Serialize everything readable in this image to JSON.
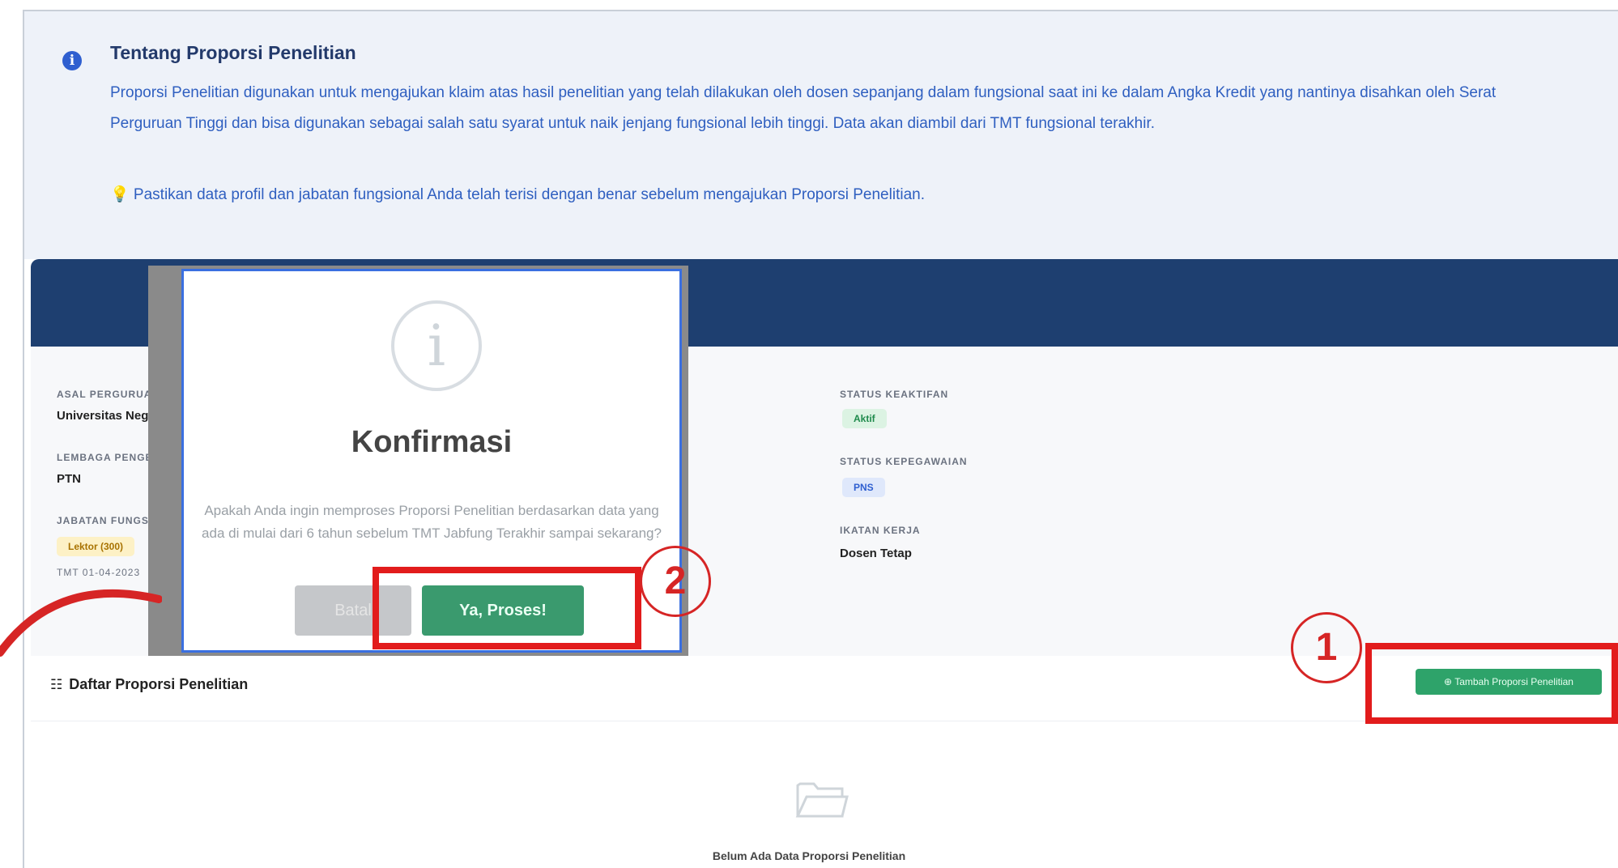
{
  "info": {
    "title": "Tentang Proporsi Penelitian",
    "text": "Proporsi Penelitian digunakan untuk mengajukan klaim atas hasil penelitian yang telah dilakukan oleh dosen sepanjang dalam fungsional saat ini ke dalam Angka Kredit yang nantinya disahkan oleh Serat Perguruan Tinggi dan bisa digunakan sebagai salah satu syarat untuk naik jenjang fungsional lebih tinggi. Data akan diambil dari TMT fungsional terakhir.",
    "tip": "💡 Pastikan data profil dan jabatan fungsional Anda telah terisi dengan benar sebelum mengajukan Proporsi Penelitian."
  },
  "profile": {
    "left": [
      {
        "label": "ASAL PERGURUAN",
        "value": "Universitas Negeri"
      },
      {
        "label": "LEMBAGA PENGEL",
        "value": "PTN"
      },
      {
        "label": "JABATAN FUNGSIO",
        "badge": "Lektor (300)",
        "sub": "TMT 01-04-2023"
      }
    ],
    "right": [
      {
        "label": "STATUS KEAKTIFAN",
        "badge": "Aktif"
      },
      {
        "label": "STATUS KEPEGAWAIAN",
        "badge": "PNS"
      },
      {
        "label": "IKATAN KERJA",
        "value": "Dosen Tetap"
      }
    ]
  },
  "list": {
    "title": "Daftar Proporsi Penelitian",
    "add_button": "⊕ Tambah Proporsi Penelitian",
    "empty_text": "Belum Ada Data Proporsi Penelitian"
  },
  "modal": {
    "icon": "i",
    "title": "Konfirmasi",
    "text": "Apakah Anda ingin memproses Proporsi Penelitian berdasarkan data yang ada di mulai dari 6 tahun sebelum TMT Jabfung Terakhir sampai sekarang?",
    "cancel": "Batal",
    "confirm": "Ya, Proses!"
  },
  "annotations": {
    "step1": "1",
    "step2": "2"
  },
  "colors": {
    "accent_navy": "#1e3f70",
    "primary_green": "#2ea36a",
    "highlight_red": "#e21c1c",
    "info_blue": "#2f5fc0"
  }
}
